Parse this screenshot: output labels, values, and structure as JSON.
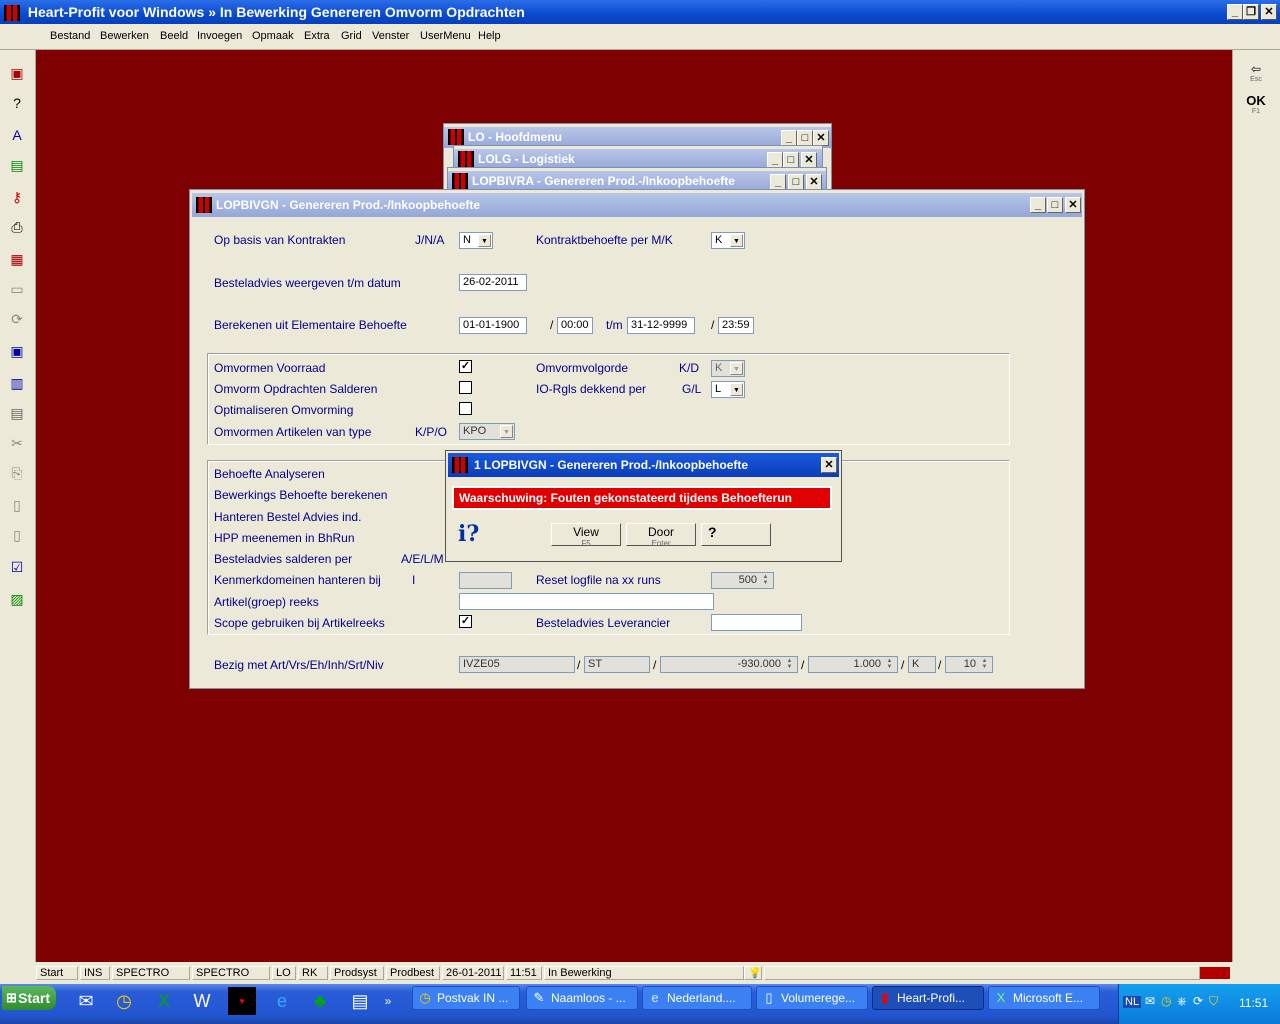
{
  "app": {
    "title": "Heart-Profit voor Windows  »  In Bewerking Genereren Omvorm Opdrachten"
  },
  "menu": [
    "Bestand",
    "Bewerken",
    "Beeld",
    "Invoegen",
    "Opmaak",
    "Extra",
    "Grid",
    "Venster",
    "UserMenu",
    "Help"
  ],
  "righttool": {
    "esc": "Esc",
    "ok": "OK",
    "f1": "F1"
  },
  "bgwindows": [
    "LO - Hoofdmenu",
    "LOLG - Logistiek",
    "LOPBIVRA - Genereren Prod.-/Inkoopbehoefte"
  ],
  "main": {
    "title": "LOPBIVGN - Genereren Prod.-/Inkoopbehoefte",
    "op_basis": "Op basis van Kontrakten",
    "jna": "J/N/A",
    "jna_val": "N",
    "kontrakt": "Kontraktbehoefte per M/K",
    "kontrakt_val": "K",
    "besteladvies": "Besteladvies weergeven t/m datum",
    "besteladvies_val": "26-02-2011",
    "berekenen": "Berekenen uit Elementaire Behoefte",
    "ber_from": "01-01-1900",
    "ber_from_t": "00:00",
    "tm": "t/m",
    "ber_to": "31-12-9999",
    "ber_to_t": "23:59",
    "omv_voorraad": "Omvormen Voorraad",
    "omv_volgorde": "Omvormvolgorde",
    "kd": "K/D",
    "kd_val": "K",
    "omv_salderen": "Omvorm Opdrachten Salderen",
    "io_rgls": "IO-Rgls dekkend per",
    "gl": "G/L",
    "gl_val": "L",
    "optimaliseren": "Optimaliseren Omvorming",
    "omv_artikelen": "Omvormen Artikelen van type",
    "kpo": "K/P/O",
    "kpo_val": "KPO",
    "behoefte_analyseren": "Behoefte Analyseren",
    "bewerkings": "Bewerkings Behoefte berekenen",
    "hanteren_bestel": "Hanteren Bestel Advies ind.",
    "hpp": "HPP meenemen in BhRun",
    "besteladvies_salderen": "Besteladvies salderen per",
    "aelm": "A/E/L/M",
    "kenmerk": "Kenmerkdomeinen hanteren bij",
    "kenmerk_code": "I",
    "reset": "Reset logfile na xx runs",
    "reset_val": "500",
    "artikelgroep": "Artikel(groep) reeks",
    "scope": "Scope gebruiken bij Artikelreeks",
    "besteladvies_lev": "Besteladvies Leverancier",
    "bezig": "Bezig met Art/Vrs/Eh/Inh/Srt/Niv",
    "bezig_art": "IVZE05",
    "bezig_vrs": "ST",
    "bezig_eh": "-930.000",
    "bezig_inh": "1.000",
    "bezig_srt": "K",
    "bezig_niv": "10",
    "slash": "/"
  },
  "dialog": {
    "title": "1 LOPBIVGN - Genereren Prod.-/Inkoopbehoefte",
    "warning": "Waarschuwing: Fouten gekonstateerd tijdens Behoefterun",
    "view": "View",
    "view_key": "F5",
    "door": "Door",
    "door_key": "Enter"
  },
  "status": [
    "Start",
    "INS",
    "SPECTRO",
    "SPECTRO",
    "LO",
    "RK",
    "Prodsyst",
    "Prodbest",
    "26-01-2011",
    "11:51",
    "In Bewerking"
  ],
  "taskbar": {
    "start": "Start",
    "items": [
      "Postvak IN ...",
      "Naamloos - ...",
      "Nederland....",
      "Volumerege...",
      "Heart-Profi...",
      "Microsoft E..."
    ],
    "lang": "NL",
    "clock": "11:51"
  }
}
